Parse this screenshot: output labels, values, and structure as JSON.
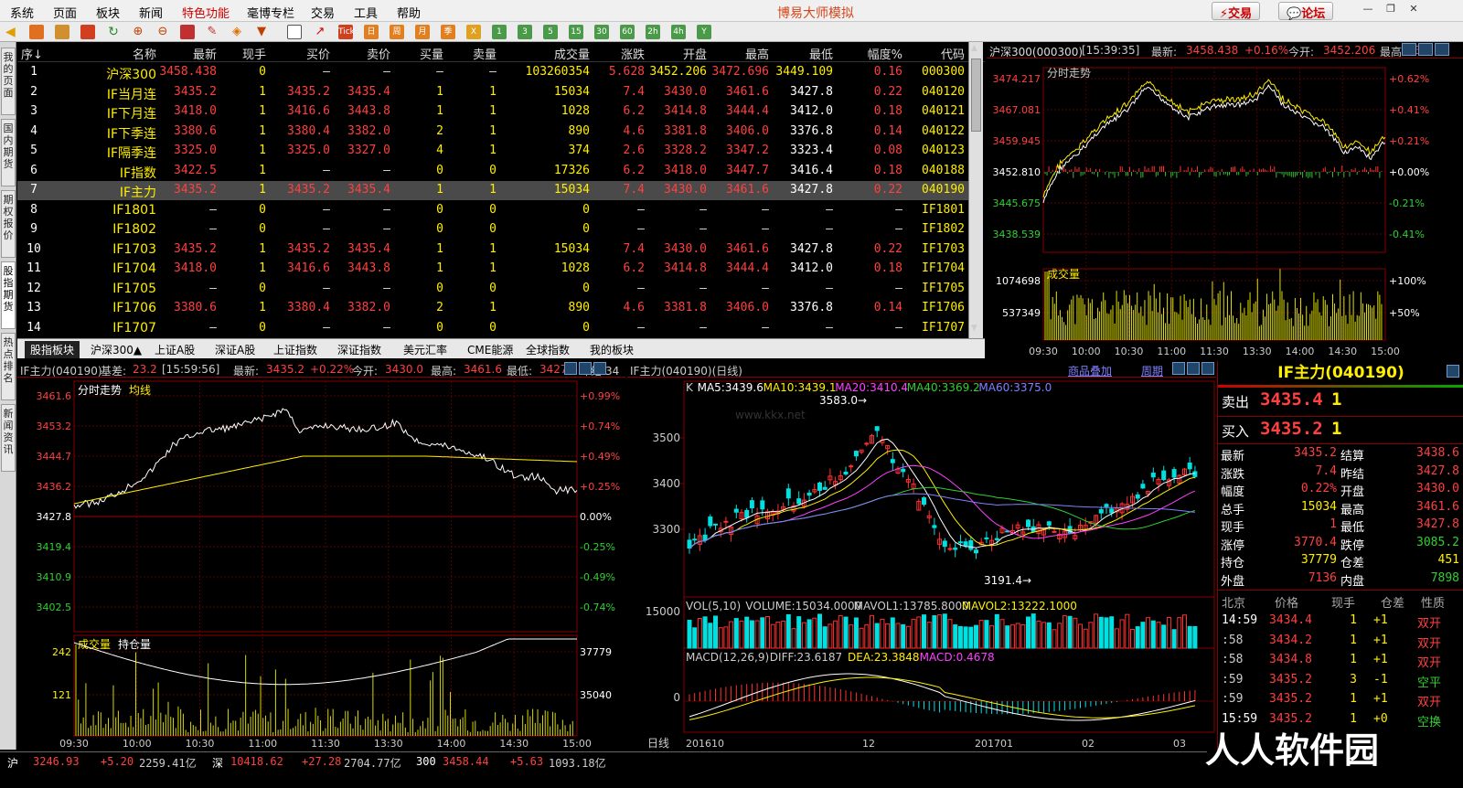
{
  "menu": {
    "items": [
      "系统",
      "页面",
      "板块",
      "新闻",
      "特色功能",
      "毫博专栏",
      "交易",
      "工具",
      "帮助"
    ],
    "title": "博易大师模拟",
    "trade": "交易",
    "forum": "论坛"
  },
  "toolbar": {
    "period_labels": [
      "Tick",
      "日",
      "周",
      "月",
      "季",
      "X",
      "1",
      "3",
      "5",
      "15",
      "30",
      "60",
      "2h",
      "4h",
      "Y"
    ]
  },
  "vtabs": [
    "我的页面",
    "国内期货",
    "期权报价",
    "股指期货",
    "热点排名",
    "新闻资讯"
  ],
  "quote": {
    "headers": [
      "序↓",
      "名称",
      "最新",
      "现手",
      "买价",
      "卖价",
      "买量",
      "卖量",
      "成交量",
      "涨跌",
      "开盘",
      "最高",
      "最低",
      "幅度%",
      "代码"
    ],
    "rows": [
      [
        "1",
        "沪深300",
        "3458.438",
        "0",
        "—",
        "—",
        "—",
        "—",
        "103260354",
        "5.628",
        "3452.206",
        "3472.696",
        "3449.109",
        "0.16",
        "000300"
      ],
      [
        "2",
        "IF当月连",
        "3435.2",
        "1",
        "3435.2",
        "3435.4",
        "1",
        "1",
        "15034",
        "7.4",
        "3430.0",
        "3461.6",
        "3427.8",
        "0.22",
        "040120"
      ],
      [
        "3",
        "IF下月连",
        "3418.0",
        "1",
        "3416.6",
        "3443.8",
        "1",
        "1",
        "1028",
        "6.2",
        "3414.8",
        "3444.4",
        "3412.0",
        "0.18",
        "040121"
      ],
      [
        "4",
        "IF下季连",
        "3380.6",
        "1",
        "3380.4",
        "3382.0",
        "2",
        "1",
        "890",
        "4.6",
        "3381.8",
        "3406.0",
        "3376.8",
        "0.14",
        "040122"
      ],
      [
        "5",
        "IF隔季连",
        "3325.0",
        "1",
        "3325.0",
        "3327.0",
        "4",
        "1",
        "374",
        "2.6",
        "3328.2",
        "3347.2",
        "3323.4",
        "0.08",
        "040123"
      ],
      [
        "6",
        "IF指数",
        "3422.5",
        "1",
        "—",
        "—",
        "0",
        "0",
        "17326",
        "6.2",
        "3418.0",
        "3447.7",
        "3416.4",
        "0.18",
        "040188"
      ],
      [
        "7",
        "IF主力",
        "3435.2",
        "1",
        "3435.2",
        "3435.4",
        "1",
        "1",
        "15034",
        "7.4",
        "3430.0",
        "3461.6",
        "3427.8",
        "0.22",
        "040190"
      ],
      [
        "8",
        "IF1801",
        "—",
        "0",
        "—",
        "—",
        "0",
        "0",
        "0",
        "—",
        "—",
        "—",
        "—",
        "—",
        "IF1801"
      ],
      [
        "9",
        "IF1802",
        "—",
        "0",
        "—",
        "—",
        "0",
        "0",
        "0",
        "—",
        "—",
        "—",
        "—",
        "—",
        "IF1802"
      ],
      [
        "10",
        "IF1703",
        "3435.2",
        "1",
        "3435.2",
        "3435.4",
        "1",
        "1",
        "15034",
        "7.4",
        "3430.0",
        "3461.6",
        "3427.8",
        "0.22",
        "IF1703"
      ],
      [
        "11",
        "IF1704",
        "3418.0",
        "1",
        "3416.6",
        "3443.8",
        "1",
        "1",
        "1028",
        "6.2",
        "3414.8",
        "3444.4",
        "3412.0",
        "0.18",
        "IF1704"
      ],
      [
        "12",
        "IF1705",
        "—",
        "0",
        "—",
        "—",
        "0",
        "0",
        "0",
        "—",
        "—",
        "—",
        "—",
        "—",
        "IF1705"
      ],
      [
        "13",
        "IF1706",
        "3380.6",
        "1",
        "3380.4",
        "3382.0",
        "2",
        "1",
        "890",
        "4.6",
        "3381.8",
        "3406.0",
        "3376.8",
        "0.14",
        "IF1706"
      ],
      [
        "14",
        "IF1707",
        "—",
        "0",
        "—",
        "—",
        "0",
        "0",
        "0",
        "—",
        "—",
        "—",
        "—",
        "—",
        "IF1707"
      ]
    ],
    "selected_row": 6
  },
  "bottom_tabs": [
    "股指板块",
    "沪深300▲",
    "上证A股",
    "深证A股",
    "上证指数",
    "深证指数",
    "美元汇率",
    "CME能源",
    "全球指数",
    "我的板块"
  ],
  "hs300_panel": {
    "title": "沪深300(000300)",
    "time": "[15:39:35]",
    "latest_label": "最新:",
    "latest": "3458.438",
    "change": "+0.16%",
    "open_label": "今开:",
    "open": "3452.206",
    "high_label": "最高:",
    "high_partial": "3",
    "sub_title": "分时走势",
    "vol_title": "成交量",
    "price_ticks": [
      "3474.217",
      "3467.081",
      "3459.945",
      "3452.810",
      "3445.675",
      "3438.539"
    ],
    "pct_ticks": [
      "+0.62%",
      "+0.41%",
      "+0.21%",
      "+0.00%",
      "-0.21%",
      "-0.41%"
    ],
    "vol_ticks": [
      "1074698",
      "537349"
    ],
    "vol_pct_ticks": [
      "+100%",
      "+50%"
    ],
    "time_ticks": [
      "09:30",
      "10:00",
      "10:30",
      "11:00",
      "11:30",
      "13:30",
      "14:00",
      "14:30",
      "15:00"
    ]
  },
  "if_intraday": {
    "title": "IF主力(040190)",
    "basis_label": "基差:",
    "basis": "23.2",
    "time": "[15:59:56]",
    "latest_label": "最新:",
    "latest": "3435.2",
    "change": "+0.22%",
    "open_label": "今开:",
    "open": "3430.0",
    "high_label": "最高:",
    "high": "3461.6",
    "low_label": "最低:",
    "low": "3427.8",
    "prev_label": "昨结:",
    "prev": "34",
    "sub_title": "分时走势",
    "avg_label": "均线",
    "price_ticks": [
      "3461.6",
      "3453.2",
      "3444.7",
      "3436.2",
      "3427.8",
      "3419.4",
      "3410.9",
      "3402.5"
    ],
    "pct_ticks": [
      "+0.99%",
      "+0.74%",
      "+0.49%",
      "+0.25%",
      "0.00%",
      "-0.25%",
      "-0.49%",
      "-0.74%"
    ],
    "vol_title": "成交量",
    "oi_title": "持仓量",
    "vol_ticks": [
      "242",
      "121"
    ],
    "oi_ticks": [
      "37779",
      "35040"
    ],
    "time_ticks": [
      "09:30",
      "10:00",
      "10:30",
      "11:00",
      "11:30",
      "13:30",
      "14:00",
      "14:30",
      "15:00"
    ]
  },
  "kline": {
    "title": "IF主力(040190)(日线)",
    "overlay_link": "商品叠加",
    "period_link": "周期",
    "ma_line": {
      "k": "K",
      "ma5": "MA5:3439.6",
      "ma10": "MA10:3439.1",
      "ma20": "MA20:3410.4",
      "ma40": "MA40:3369.2",
      "ma60": "MA60:3375.0"
    },
    "high_mark": "3583.0",
    "low_mark": "3191.4",
    "price_ticks": [
      "3500",
      "3400",
      "3300"
    ],
    "vol_line": {
      "a": "VOL(5,10)",
      "b": "VOLUME:15034.0000",
      "c": "MAVOL1:13785.8000",
      "d": "MAVOL2:13222.1000"
    },
    "vol_tick": "15000",
    "macd_line": {
      "a": "MACD(12,26,9)",
      "b": "DIFF:23.6187",
      "c": "DEA:23.3848",
      "d": "MACD:0.4678"
    },
    "macd_tick": "0",
    "period_label": "日线",
    "date_ticks": [
      "201610",
      "12",
      "201701",
      "02",
      "03"
    ],
    "watermark": "www.kkx.net"
  },
  "orderbook": {
    "title": "IF主力(040190)",
    "sell_label": "卖出",
    "sell_price": "3435.4",
    "sell_qty": "1",
    "buy_label": "买入",
    "buy_price": "3435.2",
    "buy_qty": "1",
    "stats": [
      [
        "最新",
        "3435.2",
        "结算",
        "3438.6"
      ],
      [
        "涨跌",
        "7.4",
        "昨结",
        "3427.8"
      ],
      [
        "幅度",
        "0.22%",
        "开盘",
        "3430.0"
      ],
      [
        "总手",
        "15034",
        "最高",
        "3461.6"
      ],
      [
        "现手",
        "1",
        "最低",
        "3427.8"
      ],
      [
        "涨停",
        "3770.4",
        "跌停",
        "3085.2"
      ],
      [
        "持仓",
        "37779",
        "仓差",
        "451"
      ],
      [
        "外盘",
        "7136",
        "内盘",
        "7898"
      ]
    ],
    "tick_headers": [
      "北京",
      "价格",
      "现手",
      "仓差",
      "性质"
    ],
    "ticks": [
      [
        "14:59",
        "3434.4",
        "1",
        "+1",
        "双开"
      ],
      [
        ":58",
        "3434.2",
        "1",
        "+1",
        "双开"
      ],
      [
        ":58",
        "3434.8",
        "1",
        "+1",
        "双开"
      ],
      [
        ":59",
        "3435.2",
        "3",
        "-1",
        "空平"
      ],
      [
        ":59",
        "3435.2",
        "1",
        "+1",
        "双开"
      ],
      [
        "15:59",
        "3435.2",
        "1",
        "+0",
        "空换"
      ]
    ]
  },
  "status": {
    "sh": "沪",
    "sh_v": "3246.93",
    "sh_c": "+5.20",
    "sh_amt": "2259.41亿",
    "sz": "深",
    "sz_v": "10418.62",
    "sz_c": "+27.28",
    "sz_amt": "2704.77亿",
    "i300": "300",
    "i300_v": "3458.44",
    "i300_c": "+5.63",
    "i300_amt": "1093.18亿"
  },
  "brand_watermark": "人人软件园"
}
